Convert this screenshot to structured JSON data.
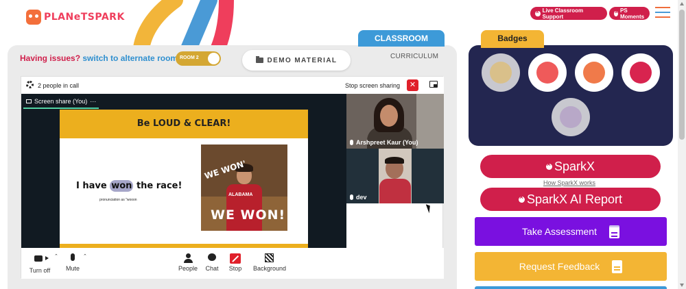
{
  "brand": {
    "logo_planet": "PLANeT",
    "logo_spark": "SPARK"
  },
  "header": {
    "live_support": "Live Classroom Support",
    "ps_moments": "PS Moments"
  },
  "tabs": {
    "classroom": "CLASSROOM",
    "curriculum": "CURRICULUM"
  },
  "issues": {
    "question": "Having issues?",
    "switch": "switch to alternate room",
    "room_toggle": "ROOM 2"
  },
  "demo_material": "DEMO MATERIAL",
  "meeting": {
    "people_in_call": "2 people in call",
    "stop_screen_sharing": "Stop screen sharing",
    "stop_x": "✕",
    "share_label": "Screen share (You)",
    "more_dots": "···",
    "participants": [
      {
        "name": "Arshpreet Kaur (You)"
      },
      {
        "name": "dev"
      }
    ]
  },
  "slide": {
    "heading": "Be LOUD & CLEAR!",
    "phrase_before": "I have ",
    "phrase_highlight": "won",
    "phrase_after": " the race!",
    "pronunciation": "pronunciation as \"wooon",
    "gif_text_top": "WE WON'",
    "gif_text_bottom": "WE WON!",
    "gif_jersey": "ALABAMA"
  },
  "toolbar": {
    "turn_off": "Turn off",
    "mute": "Mute",
    "people": "People",
    "chat": "Chat",
    "stop": "Stop",
    "background": "Background",
    "caret": "⌃"
  },
  "badges": {
    "title": "Badges",
    "items": [
      {
        "icon": "trophy-badge-icon",
        "earned": false
      },
      {
        "icon": "hand-raise-badge-icon",
        "earned": true
      },
      {
        "icon": "meditation-badge-icon",
        "earned": true
      },
      {
        "icon": "lightbulb-badge-icon",
        "earned": true
      },
      {
        "icon": "robot-planet-badge-icon",
        "earned": false
      }
    ]
  },
  "sparkx": {
    "sparkx_label": "SparkX",
    "how_link": "How SparkX works",
    "ai_report": "SparkX AI Report",
    "take_assessment": "Take Assessment",
    "request_feedback": "Request Feedback"
  },
  "colors": {
    "brand_red": "#d01f4b",
    "classroom_blue": "#3d9ad8",
    "badge_yellow": "#f3b534",
    "badges_navy": "#232650",
    "assessment_purple": "#7a10e0",
    "feedback_yellow": "#f3b534"
  }
}
